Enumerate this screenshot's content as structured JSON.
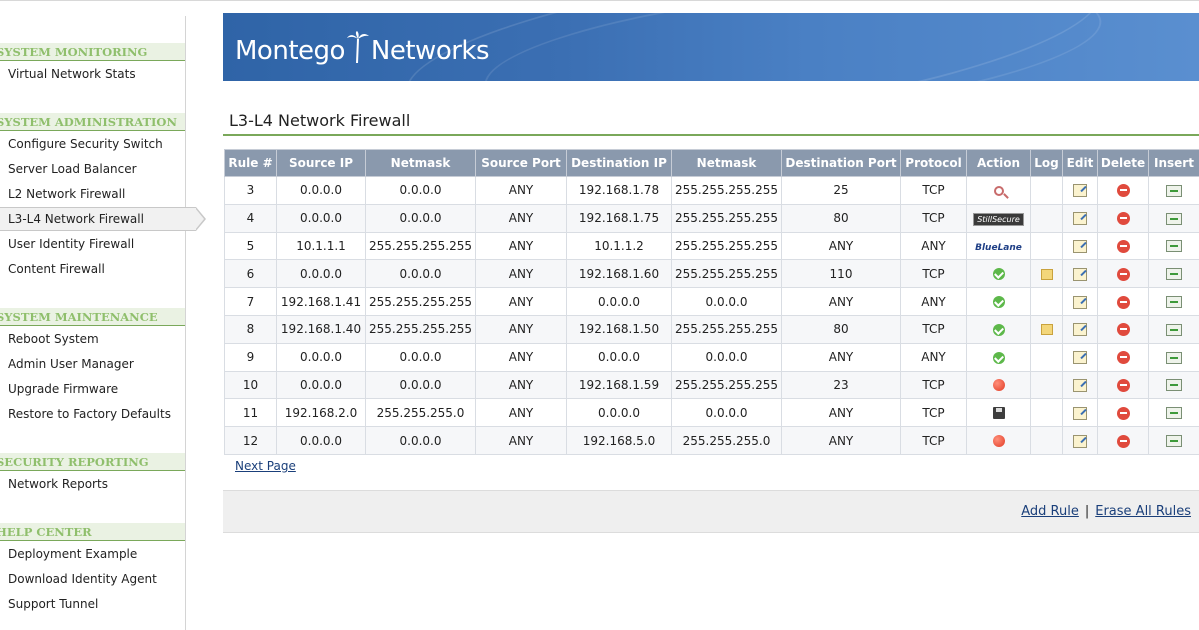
{
  "sidebar": {
    "sections": [
      {
        "title": "SYSTEM MONITORING",
        "items": [
          "Virtual Network Stats"
        ]
      },
      {
        "title": "SYSTEM ADMINISTRATION",
        "items": [
          "Configure Security Switch",
          "Server Load Balancer",
          "L2 Network Firewall",
          "L3-L4 Network Firewall",
          "User Identity Firewall",
          "Content Firewall"
        ]
      },
      {
        "title": "SYSTEM MAINTENANCE",
        "items": [
          "Reboot System",
          "Admin User Manager",
          "Upgrade Firmware",
          "Restore to Factory Defaults"
        ]
      },
      {
        "title": "SECURITY REPORTING",
        "items": [
          "Network Reports"
        ]
      },
      {
        "title": "HELP CENTER",
        "items": [
          "Deployment Example",
          "Download Identity Agent",
          "Support Tunnel"
        ]
      }
    ],
    "active_item": "L3-L4 Network Firewall"
  },
  "banner": {
    "logo_left": "Montego",
    "logo_right": "Networks"
  },
  "page": {
    "title": "L3-L4 Network Firewall"
  },
  "table": {
    "headers": [
      "Rule #",
      "Source IP",
      "Netmask",
      "Source Port",
      "Destination IP",
      "Netmask",
      "Destination Port",
      "Protocol",
      "Action",
      "Log",
      "Edit",
      "Delete",
      "Insert"
    ],
    "rows": [
      {
        "rule": "3",
        "src": "0.0.0.0",
        "smask": "0.0.0.0",
        "sport": "ANY",
        "dst": "192.168.1.78",
        "dmask": "255.255.255.255",
        "dport": "25",
        "proto": "TCP",
        "action": "key-icon",
        "log": ""
      },
      {
        "rule": "4",
        "src": "0.0.0.0",
        "smask": "0.0.0.0",
        "sport": "ANY",
        "dst": "192.168.1.75",
        "dmask": "255.255.255.255",
        "dport": "80",
        "proto": "TCP",
        "action": "stillsecure-logo",
        "log": ""
      },
      {
        "rule": "5",
        "src": "10.1.1.1",
        "smask": "255.255.255.255",
        "sport": "ANY",
        "dst": "10.1.1.2",
        "dmask": "255.255.255.255",
        "dport": "ANY",
        "proto": "ANY",
        "action": "bluelane-logo",
        "log": ""
      },
      {
        "rule": "6",
        "src": "0.0.0.0",
        "smask": "0.0.0.0",
        "sport": "ANY",
        "dst": "192.168.1.60",
        "dmask": "255.255.255.255",
        "dport": "110",
        "proto": "TCP",
        "action": "allow-icon",
        "log": "log-icon"
      },
      {
        "rule": "7",
        "src": "192.168.1.41",
        "smask": "255.255.255.255",
        "sport": "ANY",
        "dst": "0.0.0.0",
        "dmask": "0.0.0.0",
        "dport": "ANY",
        "proto": "ANY",
        "action": "allow-icon",
        "log": ""
      },
      {
        "rule": "8",
        "src": "192.168.1.40",
        "smask": "255.255.255.255",
        "sport": "ANY",
        "dst": "192.168.1.50",
        "dmask": "255.255.255.255",
        "dport": "80",
        "proto": "TCP",
        "action": "allow-icon",
        "log": "log-icon"
      },
      {
        "rule": "9",
        "src": "0.0.0.0",
        "smask": "0.0.0.0",
        "sport": "ANY",
        "dst": "0.0.0.0",
        "dmask": "0.0.0.0",
        "dport": "ANY",
        "proto": "ANY",
        "action": "allow-icon",
        "log": ""
      },
      {
        "rule": "10",
        "src": "0.0.0.0",
        "smask": "0.0.0.0",
        "sport": "ANY",
        "dst": "192.168.1.59",
        "dmask": "255.255.255.255",
        "dport": "23",
        "proto": "TCP",
        "action": "deny-icon",
        "log": ""
      },
      {
        "rule": "11",
        "src": "192.168.2.0",
        "smask": "255.255.255.0",
        "sport": "ANY",
        "dst": "0.0.0.0",
        "dmask": "0.0.0.0",
        "dport": "ANY",
        "proto": "TCP",
        "action": "save-icon",
        "log": ""
      },
      {
        "rule": "12",
        "src": "0.0.0.0",
        "smask": "0.0.0.0",
        "sport": "ANY",
        "dst": "192.168.5.0",
        "dmask": "255.255.255.0",
        "dport": "ANY",
        "proto": "TCP",
        "action": "deny-icon",
        "log": ""
      }
    ],
    "icons": {
      "edit": "edit-icon",
      "delete": "delete-icon",
      "insert": "insert-icon"
    },
    "badge_text": {
      "stillsecure": "StillSecure",
      "bluelane": "BlueLane"
    }
  },
  "pager": {
    "next_label": "Next Page"
  },
  "footer": {
    "add_label": "Add Rule",
    "separator": "|",
    "erase_label": "Erase All Rules"
  },
  "colors": {
    "header_bg": "#8a99ad",
    "section_title": "#8fbf6c",
    "accent_rule": "#7aa85a",
    "banner": "#3b6fb3"
  }
}
